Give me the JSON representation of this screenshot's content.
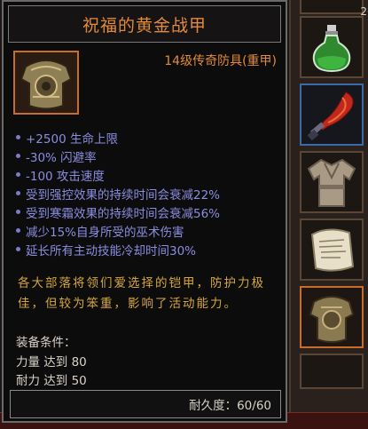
{
  "tooltip": {
    "title": "祝福的黄金战甲",
    "item_type": "14级传奇防具(重甲)",
    "affixes": [
      "+2500 生命上限",
      "-30% 闪避率",
      "-100 攻击速度",
      "受到强控效果的持续时间会衰减22%",
      "受到寒霜效果的持续时间会衰减56%",
      "减少15%自身所受的巫术伤害",
      "延长所有主动技能冷却时间30%"
    ],
    "flavor_line1": "各大部落将领们爱选择的铠甲，防护力极",
    "flavor_line2": "佳，但较为笨重，影响了活动能力。",
    "requirements_title": "装备条件：",
    "requirements": [
      "力量 达到 80",
      "耐力 达到 50"
    ],
    "durability": "耐久度：60/60",
    "item_icon": "golden-armor-icon"
  },
  "inventory": {
    "potion_count": "2",
    "slots": [
      "green-potion-icon",
      "red-sword-icon",
      "cloth-robe-icon",
      "scroll-icon",
      "golden-armor-icon"
    ]
  },
  "colors": {
    "title": "#e28a3a",
    "affix": "#8a8de0",
    "flavor": "#d6a73a",
    "text": "#d9d2c8",
    "legendary_border": "#c86c2a",
    "rare_border": "#3b6aa8"
  }
}
